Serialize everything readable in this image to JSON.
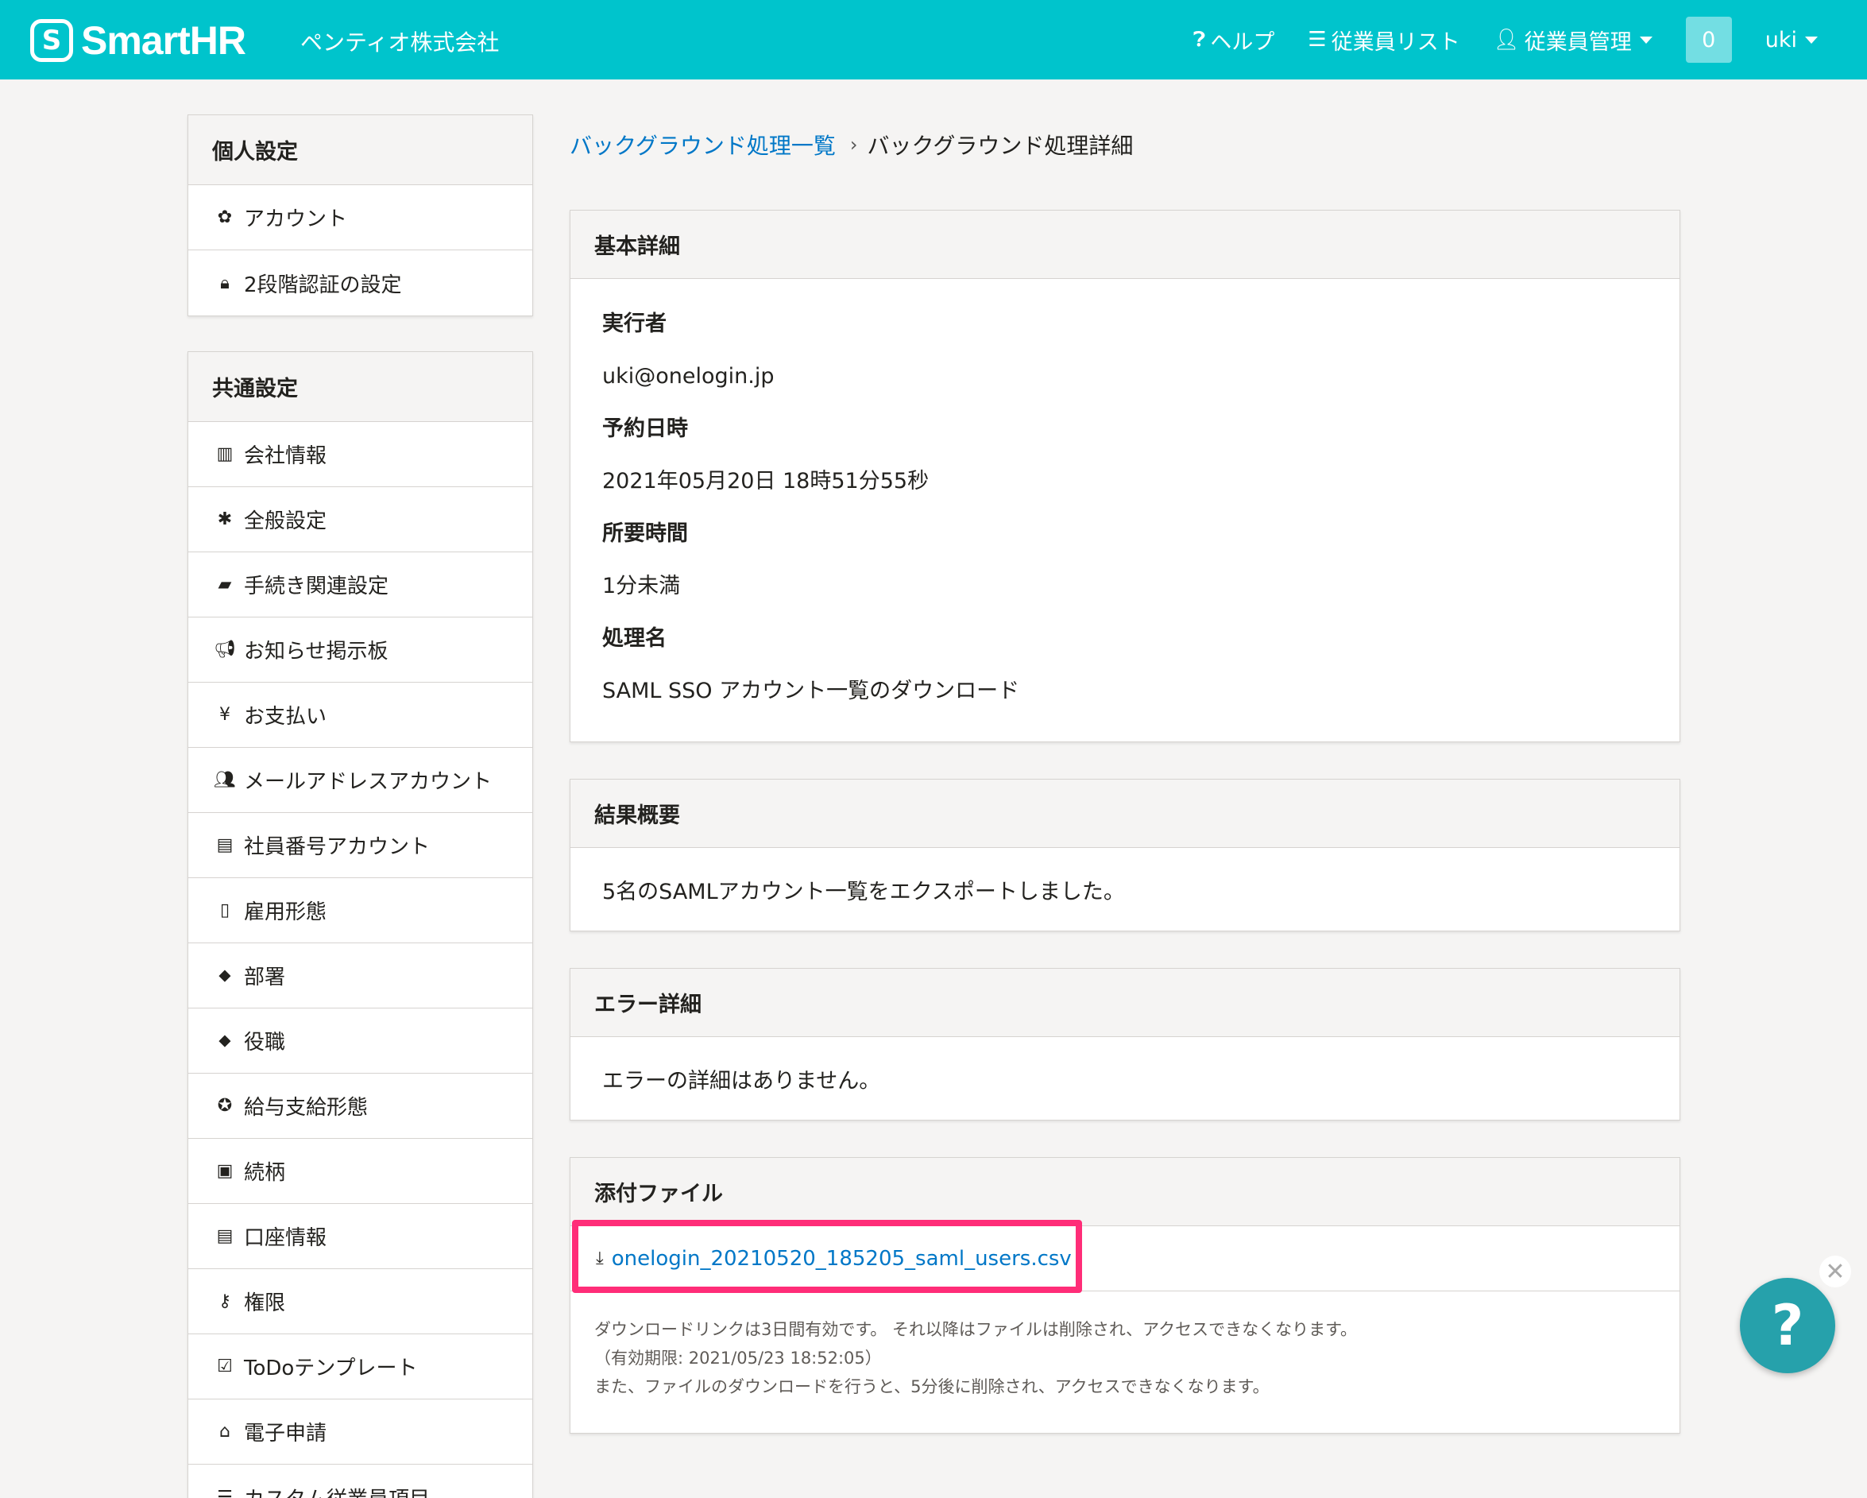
{
  "header": {
    "logo_text": "SmartHR",
    "logo_mark": "S",
    "company": "ペンティオ株式会社",
    "help_label": "ヘルプ",
    "employee_list_label": "従業員リスト",
    "employee_mgmt_label": "従業員管理",
    "notification_count": "0",
    "user_label": "uki"
  },
  "sidebar": {
    "personal": {
      "title": "個人設定",
      "items": [
        {
          "icon": "gear-icon",
          "glyph": "✿",
          "label": "アカウント"
        },
        {
          "icon": "lock-icon",
          "glyph": "🔒︎",
          "label": "2段階認証の設定"
        }
      ]
    },
    "common": {
      "title": "共通設定",
      "items": [
        {
          "icon": "building-icon",
          "glyph": "▥",
          "label": "会社情報"
        },
        {
          "icon": "asterisk-icon",
          "glyph": "✱",
          "label": "全般設定"
        },
        {
          "icon": "book-icon",
          "glyph": "▰",
          "label": "手続き関連設定"
        },
        {
          "icon": "megaphone-icon",
          "glyph": "📢︎",
          "label": "お知らせ掲示板"
        },
        {
          "icon": "yen-icon",
          "glyph": "¥",
          "label": "お支払い"
        },
        {
          "icon": "users-icon",
          "glyph": "👥︎",
          "label": "メールアドレスアカウント"
        },
        {
          "icon": "id-card-icon",
          "glyph": "▤",
          "label": "社員番号アカウント"
        },
        {
          "icon": "badge-icon",
          "glyph": "▯",
          "label": "雇用形態"
        },
        {
          "icon": "tags-icon",
          "glyph": "⬥",
          "label": "部署"
        },
        {
          "icon": "tag-icon",
          "glyph": "⬥",
          "label": "役職"
        },
        {
          "icon": "salary-icon",
          "glyph": "✪",
          "label": "給与支給形態"
        },
        {
          "icon": "contact-icon",
          "glyph": "▣",
          "label": "続柄"
        },
        {
          "icon": "card-icon",
          "glyph": "▤",
          "label": "口座情報"
        },
        {
          "icon": "user-key-icon",
          "glyph": "⚷",
          "label": "権限"
        },
        {
          "icon": "check-square-icon",
          "glyph": "☑",
          "label": "ToDoテンプレート"
        },
        {
          "icon": "bank-icon",
          "glyph": "⌂",
          "label": "電子申請"
        },
        {
          "icon": "list-icon",
          "glyph": "☰",
          "label": "カスタム従業員項目"
        }
      ]
    }
  },
  "breadcrumb": {
    "parent": "バックグラウンド処理一覧",
    "current": "バックグラウンド処理詳細"
  },
  "basic": {
    "title": "基本詳細",
    "executor_label": "実行者",
    "executor_value": "uki@onelogin.jp",
    "scheduled_label": "予約日時",
    "scheduled_value": "2021年05月20日 18時51分55秒",
    "duration_label": "所要時間",
    "duration_value": "1分未満",
    "process_label": "処理名",
    "process_value": "SAML SSO アカウント一覧のダウンロード"
  },
  "result": {
    "title": "結果概要",
    "text": "5名のSAMLアカウント一覧をエクスポートしました。"
  },
  "error": {
    "title": "エラー詳細",
    "text": "エラーの詳細はありません。"
  },
  "attachment": {
    "title": "添付ファイル",
    "filename": "onelogin_20210520_185205_saml_users.csv",
    "note_line1": "ダウンロードリンクは3日間有効です。 それ以降はファイルは削除され、アクセスできなくなります。",
    "note_line2": "（有効期限: 2021/05/23 18:52:05）",
    "note_line3": "また、ファイルのダウンロードを行うと、5分後に削除され、アクセスできなくなります。"
  },
  "fab": {
    "glyph": "?",
    "close_glyph": "✕"
  },
  "colors": {
    "brand": "#00c4cc",
    "link": "#0077c7",
    "highlight": "#ff2d78",
    "fab": "#26a1ab"
  }
}
